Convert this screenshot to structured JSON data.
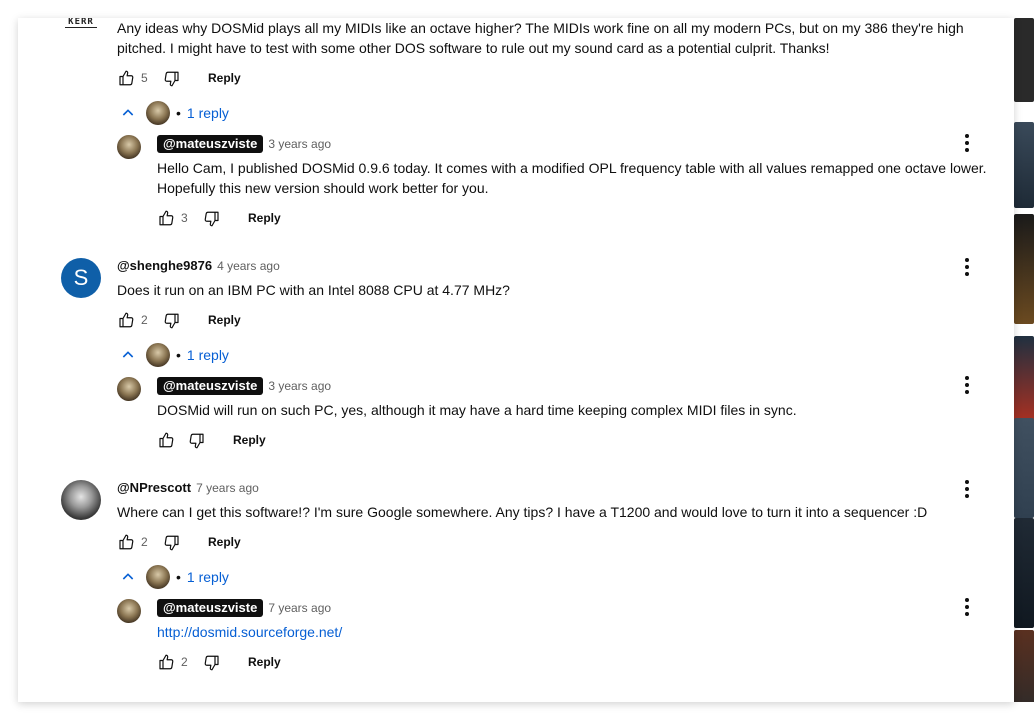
{
  "comments": [
    {
      "text": "Any ideas why DOSMid plays all my MIDIs like an octave higher? The MIDIs work fine on all my modern PCs, but on my 386 they're high pitched. I might have to test with some other DOS software to rule out my sound card as a potential culprit. Thanks!",
      "likes": "5",
      "reply_label": "Reply",
      "replies_label": "1 reply",
      "avatar_text": "KERR",
      "reply": {
        "author": "@mateuszviste",
        "time": "3 years ago",
        "text": "Hello Cam, I published DOSMid 0.9.6 today. It comes with a modified OPL frequency table with all values remapped one octave lower. Hopefully this new version should work better for you.",
        "likes": "3",
        "reply_label": "Reply"
      }
    },
    {
      "author": "@shenghe9876",
      "time": "4 years ago",
      "text": "Does it run on an IBM PC with an Intel 8088 CPU at 4.77 MHz?",
      "likes": "2",
      "reply_label": "Reply",
      "replies_label": "1 reply",
      "avatar_letter": "S",
      "avatar_color": "#0f5fa8",
      "reply": {
        "author": "@mateuszviste",
        "time": "3 years ago",
        "text": "DOSMid will run on such PC, yes, although it may have a hard time keeping complex MIDI files in sync.",
        "likes": "",
        "reply_label": "Reply"
      }
    },
    {
      "author": "@NPrescott",
      "time": "7 years ago",
      "text": "Where can I get this software!? I'm sure Google somewhere. Any tips? I have a T1200 and would love to turn it into a sequencer :D",
      "likes": "2",
      "reply_label": "Reply",
      "replies_label": "1 reply",
      "reply": {
        "author": "@mateuszviste",
        "time": "7 years ago",
        "link": "http://dosmid.sourceforge.net/",
        "likes": "2",
        "reply_label": "Reply"
      }
    }
  ],
  "separator_dot": "•"
}
